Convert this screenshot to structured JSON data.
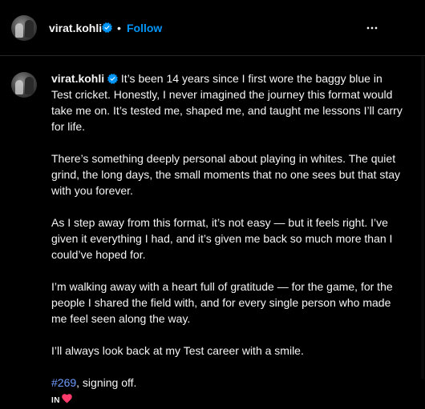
{
  "header": {
    "username": "virat.kohli",
    "separator": "•",
    "follow_label": "Follow",
    "more_icon": "more-horizontal-icon"
  },
  "post": {
    "username": "virat.kohli",
    "paragraphs": [
      "It’s been 14 years since I first wore the baggy blue in Test cricket. Honestly, I never imagined the journey this format would take me on. It’s tested me, shaped me, and taught me lessons I’ll carry for life.",
      "There’s something deeply personal about playing in whites. The quiet grind, the long days, the small moments that no one sees but that stay with you forever.",
      "As I step away from this format, it’s not easy — but it feels right. I’ve given it everything I had, and it’s given me back so much more than I could’ve hoped for.",
      "I’m walking away with a heart full of gratitude — for the game, for the people I shared the field with, and for every single person who made me feel seen along the way.",
      "I’ll always look back at my Test career with a smile."
    ],
    "hashtag": "#269",
    "signoff_rest": ", signing off.",
    "signature": "IN",
    "heart_icon": "heart-icon"
  },
  "colors": {
    "background": "#000000",
    "text": "#f5f5f5",
    "accent": "#0095f6",
    "hashtag": "#6f9bff",
    "verified": "#0095f6",
    "heart": "#ff3b6b"
  }
}
